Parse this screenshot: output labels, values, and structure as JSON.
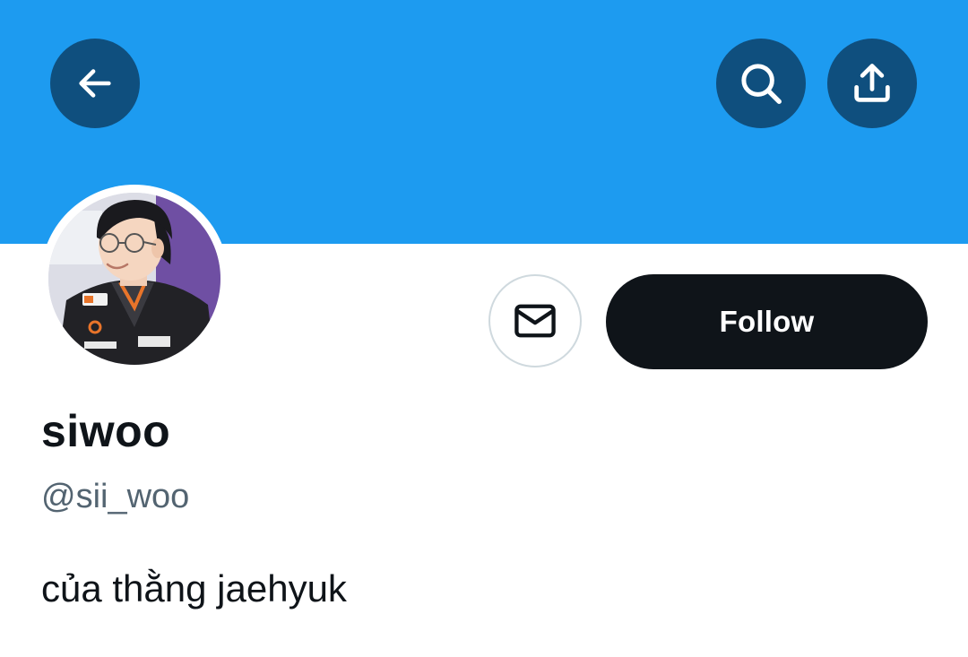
{
  "colors": {
    "banner": "#1d9bf0",
    "header_button_bg": "#0f4f7e",
    "follow_bg": "#0f1419",
    "follow_text": "#ffffff",
    "primary_text": "#0f1419",
    "secondary_text": "#536471",
    "outline": "#cfd9de"
  },
  "header": {
    "back_icon": "arrow-left-icon",
    "search_icon": "search-icon",
    "share_icon": "share-upload-icon"
  },
  "profile": {
    "display_name": "siwoo",
    "handle": "@sii_woo",
    "bio": "của thằng jaehyuk"
  },
  "actions": {
    "message_icon": "envelope-icon",
    "follow_label": "Follow"
  }
}
